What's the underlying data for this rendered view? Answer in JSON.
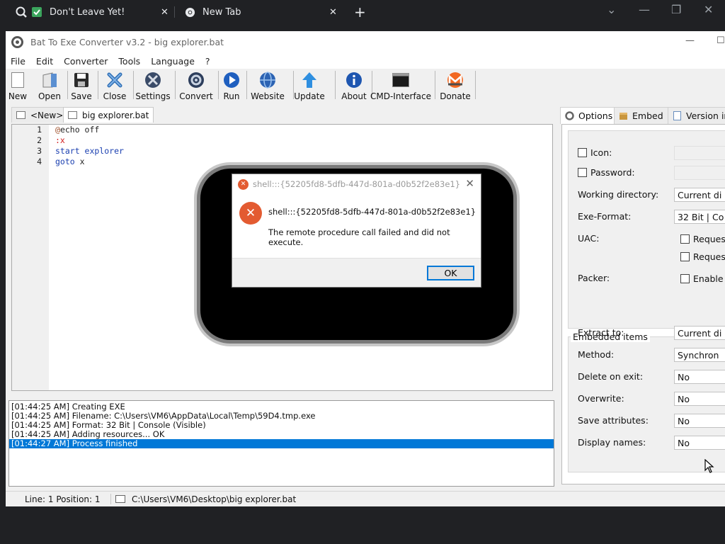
{
  "browser": {
    "tabs": [
      {
        "title": "Don't Leave Yet!",
        "close": "✕"
      },
      {
        "title": "New Tab",
        "close": "✕"
      }
    ],
    "new_tab": "+",
    "controls": {
      "chevron": "⌄",
      "minimize": "—",
      "restore": "❐",
      "close": "✕"
    }
  },
  "window": {
    "title": "Bat To Exe Converter v3.2 - big explorer.bat",
    "minimize": "—",
    "maximize": "☐"
  },
  "menu": [
    "File",
    "Edit",
    "Converter",
    "Tools",
    "Language",
    "?"
  ],
  "toolbar": {
    "new": "New",
    "open": "Open",
    "save": "Save",
    "close": "Close",
    "settings": "Settings",
    "convert": "Convert",
    "run": "Run",
    "website": "Website",
    "update": "Update",
    "about": "About",
    "cmd": "CMD-Interface",
    "donate": "Donate"
  },
  "editor_tabs": [
    "<New>",
    "big explorer.bat"
  ],
  "code": {
    "line_numbers": [
      "1",
      "2",
      "3",
      "4"
    ],
    "lines": [
      "@echo off",
      ":x",
      "start explorer",
      "goto x"
    ]
  },
  "log": [
    "[01:44:25 AM] Creating EXE",
    "[01:44:25 AM] Filename: C:\\Users\\VM6\\AppData\\Local\\Temp\\59D4.tmp.exe",
    "[01:44:25 AM] Format: 32 Bit | Console (Visible)",
    "[01:44:25 AM] Adding resources... OK",
    "[01:44:27 AM] Process finished"
  ],
  "status": {
    "line_pos": "Line: 1  Position: 1",
    "path": "C:\\Users\\VM6\\Desktop\\big explorer.bat"
  },
  "panel": {
    "tabs": [
      "Options",
      "Embed",
      "Version in"
    ],
    "options": {
      "icon": "Icon:",
      "password": "Password:",
      "working_dir": "Working directory:",
      "working_dir_value": "Current di",
      "exe_format": "Exe-Format:",
      "exe_format_value": "32 Bit | Co",
      "uac": "UAC:",
      "uac_1": "Request",
      "uac_2": "Request",
      "packer": "Packer:",
      "packer_value": "Enable U"
    },
    "embedded": {
      "title": "Embedded items",
      "extract_to": "Extract to:",
      "extract_to_value": "Current di",
      "method": "Method:",
      "method_value": "Synchron",
      "delete_on_exit": "Delete on exit:",
      "delete_on_exit_value": "No",
      "overwrite": "Overwrite:",
      "overwrite_value": "No",
      "save_attributes": "Save attributes:",
      "save_attributes_value": "No",
      "display_names": "Display names:",
      "display_names_value": "No"
    }
  },
  "dialog": {
    "title": "shell:::{52205fd8-5dfb-447d-801a-d0b52f2e83e1}",
    "heading": "shell:::{52205fd8-5dfb-447d-801a-d0b52f2e83e1}",
    "message": "The remote procedure call failed and did not execute.",
    "ok": "OK",
    "close": "✕"
  },
  "colors": {
    "accent": "#0078d7",
    "error": "#e35b31",
    "browser_bg": "#202124"
  }
}
